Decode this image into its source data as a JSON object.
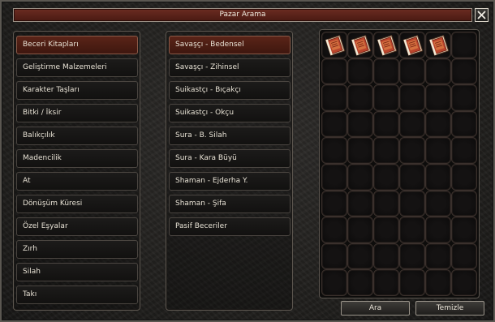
{
  "window": {
    "title": "Pazar Arama"
  },
  "categories": [
    {
      "label": "Beceri Kitapları",
      "selected": true
    },
    {
      "label": "Geliştirme Malzemeleri",
      "selected": false
    },
    {
      "label": "Karakter Taşları",
      "selected": false
    },
    {
      "label": "Bitki / İksir",
      "selected": false
    },
    {
      "label": "Balıkçılık",
      "selected": false
    },
    {
      "label": "Madencilik",
      "selected": false
    },
    {
      "label": "At",
      "selected": false
    },
    {
      "label": "Dönüşüm Küresi",
      "selected": false
    },
    {
      "label": "Özel Eşyalar",
      "selected": false
    },
    {
      "label": "Zırh",
      "selected": false
    },
    {
      "label": "Silah",
      "selected": false
    },
    {
      "label": "Takı",
      "selected": false
    }
  ],
  "subcategories": [
    {
      "label": "Savaşçı - Bedensel",
      "selected": true
    },
    {
      "label": "Savaşçı - Zihinsel",
      "selected": false
    },
    {
      "label": "Suikastçı - Bıçakçı",
      "selected": false
    },
    {
      "label": "Suikastçı - Okçu",
      "selected": false
    },
    {
      "label": "Sura - B. Silah",
      "selected": false
    },
    {
      "label": "Sura - Kara Büyü",
      "selected": false
    },
    {
      "label": "Shaman - Ejderha Y.",
      "selected": false
    },
    {
      "label": "Shaman - Şifa",
      "selected": false
    },
    {
      "label": "Pasif Beceriler",
      "selected": false
    }
  ],
  "item_grid": {
    "columns": 6,
    "rows": 10,
    "filled_slots": [
      0,
      1,
      2,
      3,
      4
    ],
    "item_icon": "skill-book-icon"
  },
  "buttons": {
    "search": "Ara",
    "clear": "Temizle"
  },
  "colors": {
    "selected": "#5a2418",
    "title_bar": "#6b2c22",
    "book_cover": "#b9442c"
  }
}
